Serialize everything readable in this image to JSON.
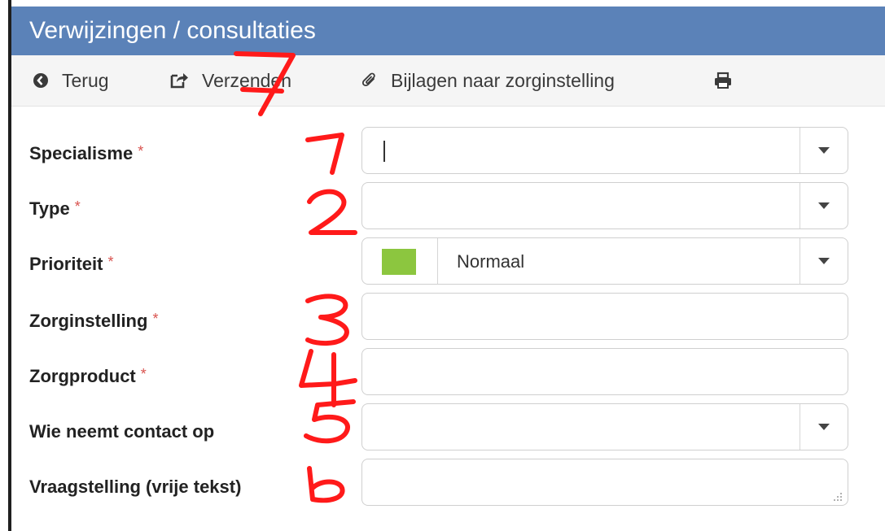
{
  "window": {
    "title": "Verwijzingen / consultaties"
  },
  "toolbar": {
    "back_label": "Terug",
    "send_label": "Verzenden",
    "attach_label": "Bijlagen naar zorginstelling"
  },
  "form": {
    "required_marker": "*",
    "fields": [
      {
        "label": "Specialisme",
        "required": true,
        "value": ""
      },
      {
        "label": "Type",
        "required": true,
        "value": ""
      },
      {
        "label": "Prioriteit",
        "required": true,
        "value": "Normaal"
      },
      {
        "label": "Zorginstelling",
        "required": true,
        "value": ""
      },
      {
        "label": "Zorgproduct",
        "required": true,
        "value": ""
      },
      {
        "label": "Wie neemt contact op",
        "required": false,
        "value": ""
      },
      {
        "label": "Vraagstelling (vrije tekst)",
        "required": false,
        "value": ""
      }
    ]
  },
  "annotations": [
    "1",
    "2",
    "3",
    "4",
    "5",
    "6",
    "7"
  ],
  "colors": {
    "header_bg": "#5b82b8",
    "priority_normal": "#8cc63f",
    "annotation_red": "#ff1a1a",
    "required_star": "#d9534f"
  },
  "icons": {
    "back": "circle-chevron-left-icon",
    "send": "share-square-icon",
    "attach": "paperclip-icon",
    "print": "print-icon",
    "dropdown": "caret-down-icon",
    "resize": "resize-grip-icon"
  }
}
